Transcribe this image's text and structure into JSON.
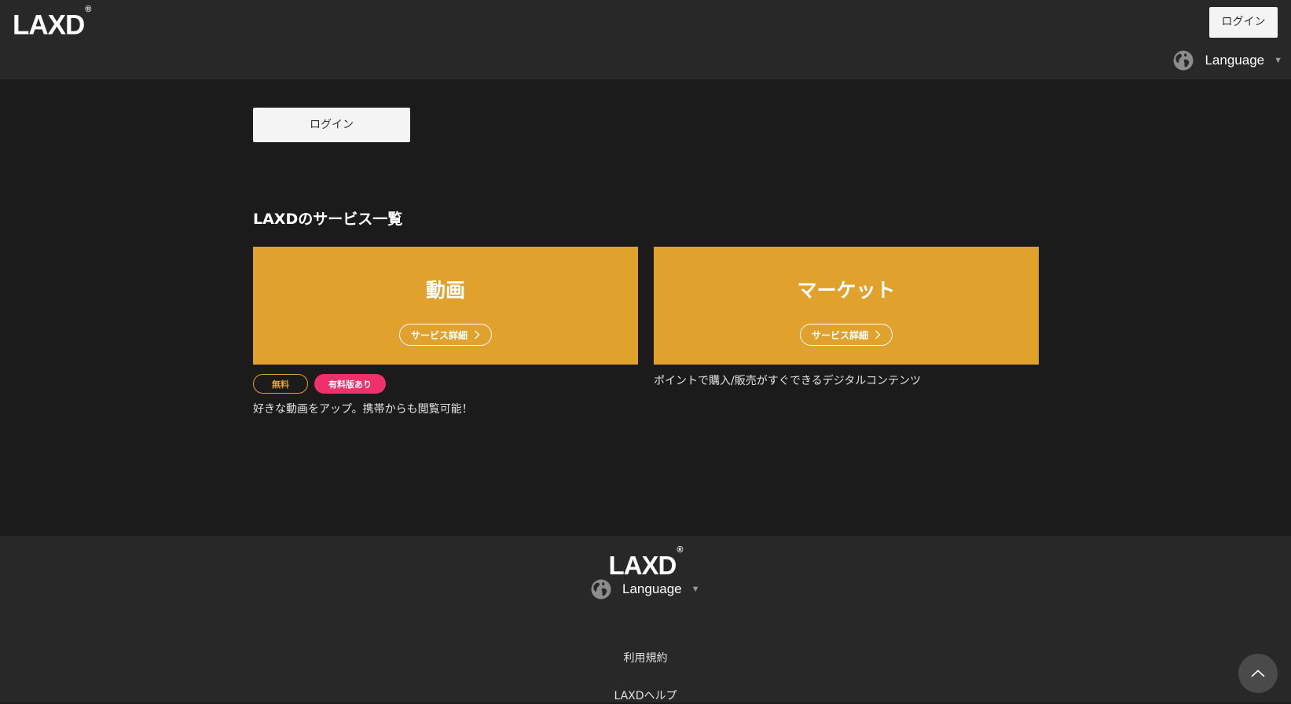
{
  "header": {
    "logo": "LAXD",
    "logo_mark": "®",
    "login_label": "ログイン",
    "language_label": "Language",
    "language_caret": "▼"
  },
  "main": {
    "login_label": "ログイン",
    "section_title": "LAXDのサービス一覧",
    "services": [
      {
        "title": "動画",
        "detail_label": "サービス詳細",
        "badges": [
          "無料",
          "有料版あり"
        ],
        "description": "好きな動画をアップ。携帯からも閲覧可能！"
      },
      {
        "title": "マーケット",
        "detail_label": "サービス詳細",
        "description": "ポイントで購入/販売がすぐできるデジタルコンテンツ"
      }
    ]
  },
  "footer": {
    "logo": "LAXD",
    "logo_mark": "®",
    "language_label": "Language",
    "language_caret": "▼",
    "links": [
      "利用規約",
      "LAXDヘルプ"
    ]
  },
  "icons": {
    "globe": "globe-icon",
    "chevron_right": "chevron-right-icon",
    "chevron_up": "chevron-up-icon"
  },
  "colors": {
    "background": "#1b1b1b",
    "bar": "#282828",
    "card": "#e0a12d",
    "badge_free": "#e0a12d",
    "badge_paid": "#f0306b"
  }
}
